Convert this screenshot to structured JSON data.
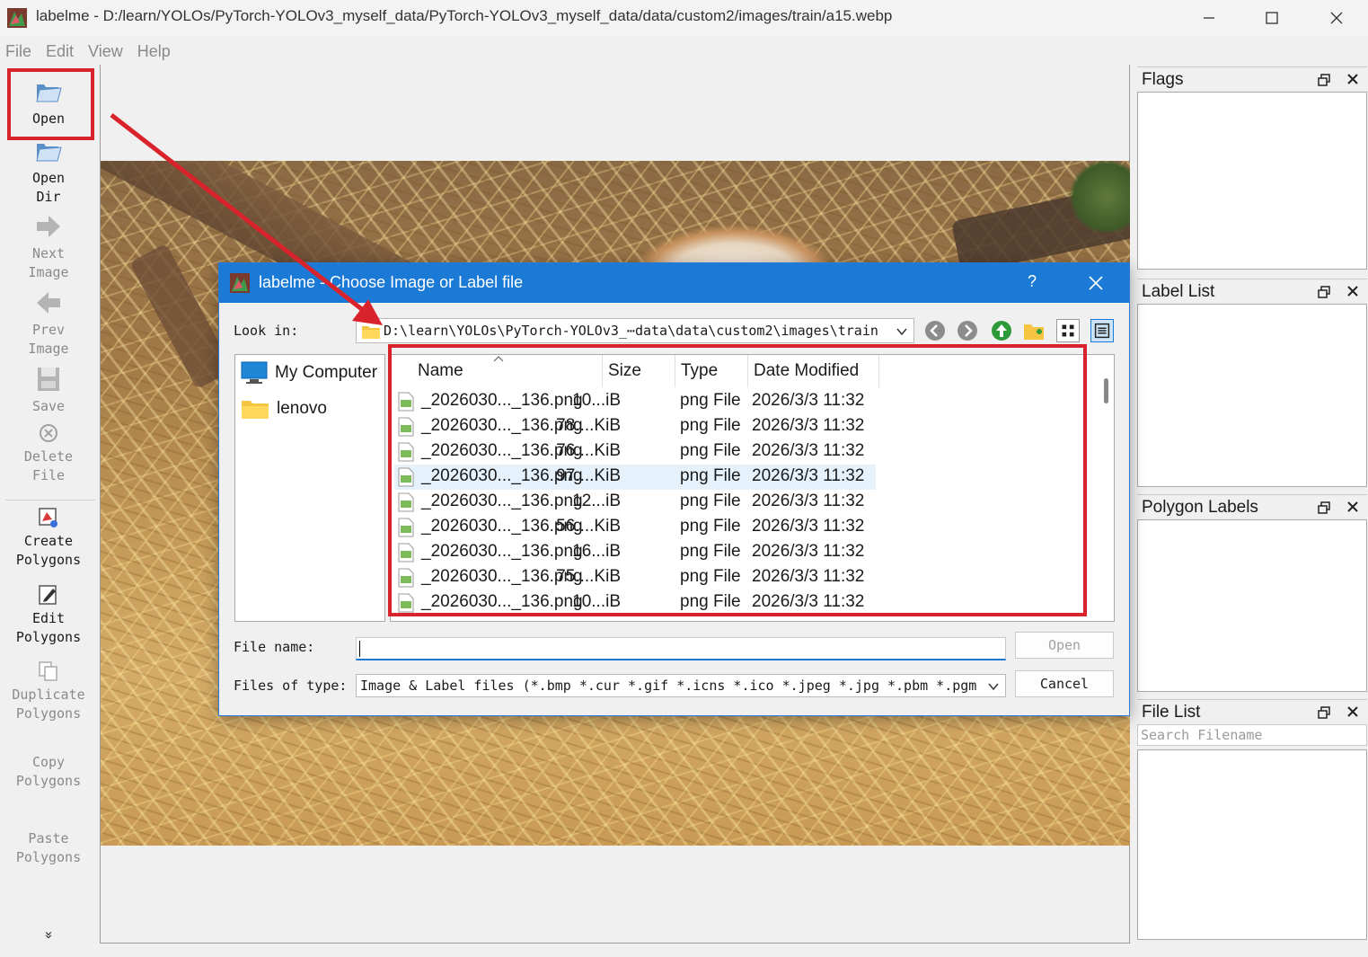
{
  "window": {
    "title": "labelme - D:/learn/YOLOs/PyTorch-YOLOv3_myself_data/PyTorch-YOLOv3_myself_data/data/custom2/images/train/a15.webp"
  },
  "menu": [
    "File",
    "Edit",
    "View",
    "Help"
  ],
  "toolbar": {
    "open": "Open",
    "open_dir": [
      "Open",
      "Dir"
    ],
    "next_image": [
      "Next",
      "Image"
    ],
    "prev_image": [
      "Prev",
      "Image"
    ],
    "save": "Save",
    "delete_file": [
      "Delete",
      "File"
    ],
    "create_polygons": [
      "Create",
      "Polygons"
    ],
    "edit_polygons": [
      "Edit",
      "Polygons"
    ],
    "duplicate_polygons": [
      "Duplicate",
      "Polygons"
    ],
    "copy_polygons": [
      "Copy",
      "Polygons"
    ],
    "paste_polygons": [
      "Paste",
      "Polygons"
    ],
    "more": "»"
  },
  "docks": {
    "flags": "Flags",
    "label_list": "Label List",
    "polygon_labels": "Polygon Labels",
    "file_list": "File List",
    "search_placeholder": "Search Filename"
  },
  "dialog": {
    "title": "labelme - Choose Image or Label file",
    "help": "?",
    "look_in_label": "Look in:",
    "look_in_path": "D:\\learn\\YOLOs\\PyTorch-YOLOv3_⋯data\\data\\custom2\\images\\train",
    "sidebar": [
      "My Computer",
      "lenovo"
    ],
    "columns": [
      "Name",
      "Size",
      "Type",
      "Date Modified"
    ],
    "rows": [
      {
        "name": "_2026030..._136.png",
        "size": "10...iB",
        "type": "png File",
        "date": "2026/3/3 11:32",
        "selected": false
      },
      {
        "name": "_2026030..._136.png",
        "size": "78....KiB",
        "type": "png File",
        "date": "2026/3/3 11:32",
        "selected": false
      },
      {
        "name": "_2026030..._136.png",
        "size": "76....KiB",
        "type": "png File",
        "date": "2026/3/3 11:32",
        "selected": false
      },
      {
        "name": "_2026030..._136.png",
        "size": "97....KiB",
        "type": "png File",
        "date": "2026/3/3 11:32",
        "selected": true
      },
      {
        "name": "_2026030..._136.png",
        "size": "12...iB",
        "type": "png File",
        "date": "2026/3/3 11:32",
        "selected": false
      },
      {
        "name": "_2026030..._136.png",
        "size": "56....KiB",
        "type": "png File",
        "date": "2026/3/3 11:32",
        "selected": false
      },
      {
        "name": "_2026030..._136.png",
        "size": "16...iB",
        "type": "png File",
        "date": "2026/3/3 11:32",
        "selected": false
      },
      {
        "name": "_2026030..._136.png",
        "size": "75....KiB",
        "type": "png File",
        "date": "2026/3/3 11:32",
        "selected": false
      },
      {
        "name": "_2026030..._136.png",
        "size": "10...iB",
        "type": "png File",
        "date": "2026/3/3 11:32",
        "selected": false
      }
    ],
    "file_name_label": "File name:",
    "file_name_value": "",
    "files_of_type_label": "Files of type:",
    "files_of_type_value": "Image & Label files (*.bmp *.cur *.gif *.icns *.ico *.jpeg *.jpg *.pbm *.pgm",
    "open_button": "Open",
    "cancel_button": "Cancel"
  },
  "colors": {
    "accent": "#1a7ad6",
    "annotation_red": "#d9232c",
    "selected_row": "#e5f1fb"
  }
}
